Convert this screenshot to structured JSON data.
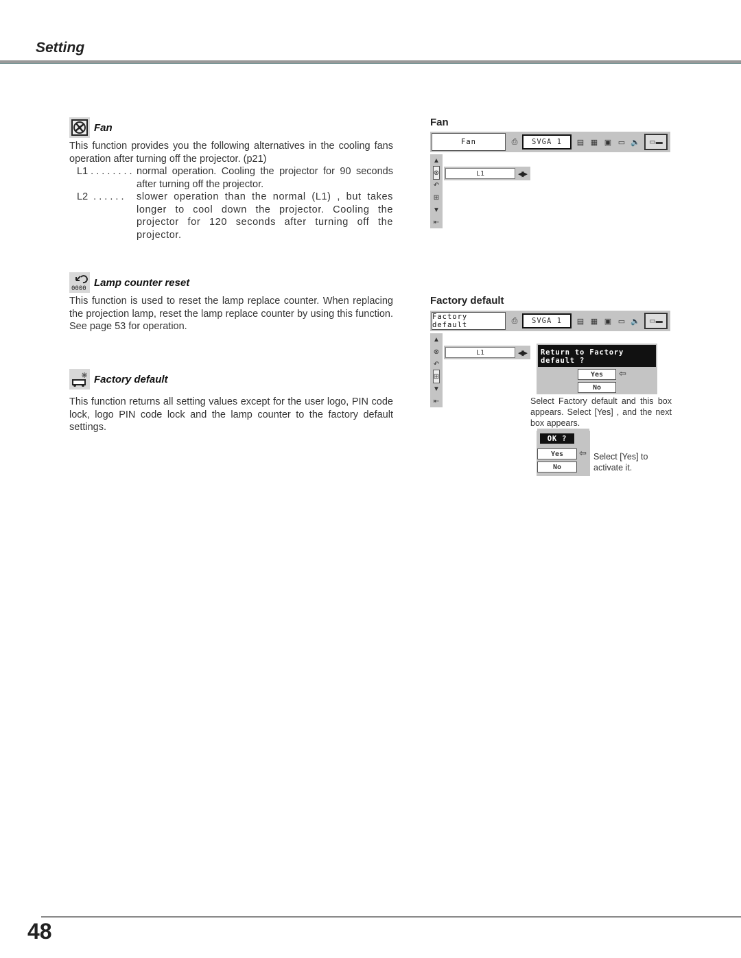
{
  "header": {
    "title": "Setting"
  },
  "footer": {
    "page_number": "48"
  },
  "sections": {
    "fan": {
      "title": "Fan",
      "icon": "fan-icon",
      "body": "This function provides you the following alternatives in the cooling fans operation after turning off the projector.  (p21)",
      "items": [
        {
          "key": "L1 . . . . . . . .",
          "desc": "normal operation. Cooling the projector for 90 seconds after turning off the projector."
        },
        {
          "key": "L2  . . . . . .",
          "desc": "slower operation than the normal (L1) , but takes longer to cool down the projector. Cooling the projector for 120 seconds after turning off the projector."
        }
      ]
    },
    "lamp": {
      "title": "Lamp counter reset",
      "icon": "lamp-counter-reset-icon",
      "body": "This function is used to reset the lamp replace counter.  When replacing the projection lamp, reset the lamp replace counter by using this function.  See page 53 for operation."
    },
    "factory": {
      "title": "Factory default",
      "icon": "factory-default-icon",
      "body": "This function returns all setting values except for the user logo, PIN code lock, logo PIN code lock and the lamp counter to the factory default settings."
    }
  },
  "figures": {
    "fan": {
      "title": "Fan",
      "menu_label": "Fan",
      "source": "SVGA 1",
      "value": "L1"
    },
    "factory": {
      "title": "Factory default",
      "menu_label": "Factory default",
      "source": "SVGA 1",
      "value": "L1",
      "dialog1": {
        "title": "Return to Factory default ?",
        "yes": "Yes",
        "no": "No"
      },
      "caption1": "Select Factory default and this box appears.  Select [Yes] , and the next box appears.",
      "dialog2": {
        "title": "OK ?",
        "yes": "Yes",
        "no": "No"
      },
      "caption2": "Select [Yes] to activate it."
    }
  }
}
